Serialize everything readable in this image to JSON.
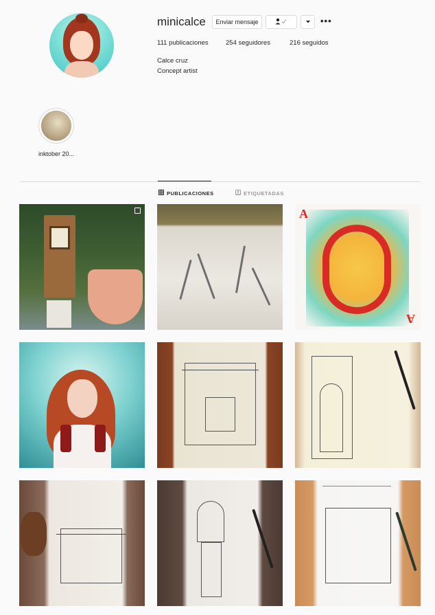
{
  "profile": {
    "username": "minicalce",
    "message_button": "Enviar mensaje",
    "posts": "111 publicaciones",
    "followers": "254 seguidores",
    "following": "216 seguidos",
    "full_name": "Calce cruz",
    "bio": "Concept artist"
  },
  "highlights": [
    {
      "label": "inktober 20..."
    }
  ],
  "tabs": [
    {
      "label": "PUBLICACIONES",
      "active": true
    },
    {
      "label": "ETIQUETADAS",
      "active": false
    }
  ],
  "icons": {
    "follow": "person-check-icon",
    "dropdown": "chevron-down-icon",
    "more": "more-dots-icon",
    "posts_tab": "grid-icon",
    "tagged_tab": "tag-icon",
    "multi": "multiple-images-icon"
  },
  "colors": {
    "text": "#262626",
    "border": "#dbdbdb",
    "background": "#fafafa"
  }
}
